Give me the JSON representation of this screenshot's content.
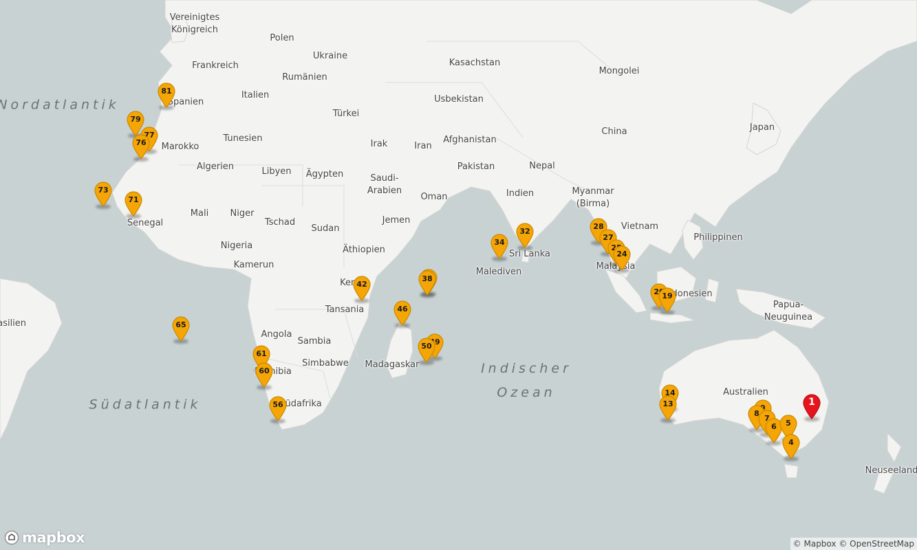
{
  "map": {
    "colors": {
      "water": "#c9d2d3",
      "land": "#f3f3f1",
      "border": "#d4d4d2",
      "marker": "#f5a506",
      "marker_stroke": "#c98a00",
      "marker_active": "#e8141c"
    },
    "country_labels": [
      {
        "text": "Vereinigtes\nKönigreich"
      },
      {
        "text": "Polen"
      },
      {
        "text": "Ukraine"
      },
      {
        "text": "Frankreich"
      },
      {
        "text": "Rumänien"
      },
      {
        "text": "Kasachstan"
      },
      {
        "text": "Mongolei"
      },
      {
        "text": "Spanien"
      },
      {
        "text": "Italien"
      },
      {
        "text": "Usbekistan"
      },
      {
        "text": "Türkei"
      },
      {
        "text": "China"
      },
      {
        "text": "Japan"
      },
      {
        "text": "Marokko"
      },
      {
        "text": "Tunesien"
      },
      {
        "text": "Irak"
      },
      {
        "text": "Iran"
      },
      {
        "text": "Afghanistan"
      },
      {
        "text": "Algerien"
      },
      {
        "text": "Libyen"
      },
      {
        "text": "Ägypten"
      },
      {
        "text": "Pakistan"
      },
      {
        "text": "Nepal"
      },
      {
        "text": "Saudi-\nArabien"
      },
      {
        "text": "Indien"
      },
      {
        "text": "Oman"
      },
      {
        "text": "Myanmar\n(Birma)"
      },
      {
        "text": "Mali"
      },
      {
        "text": "Niger"
      },
      {
        "text": "Senegal"
      },
      {
        "text": "Tschad"
      },
      {
        "text": "Sudan"
      },
      {
        "text": "Jemen"
      },
      {
        "text": "Vietnam"
      },
      {
        "text": "Philippinen"
      },
      {
        "text": "Nigeria"
      },
      {
        "text": "Äthiopien"
      },
      {
        "text": "Kamerun"
      },
      {
        "text": "Sri Lanka"
      },
      {
        "text": "Malaysia"
      },
      {
        "text": "Malediven"
      },
      {
        "text": "Kenia"
      },
      {
        "text": "Tansania"
      },
      {
        "text": "Indonesien"
      },
      {
        "text": "Papua-\nNeuguinea"
      },
      {
        "text": "Brasilien"
      },
      {
        "text": "Angola"
      },
      {
        "text": "Sambia"
      },
      {
        "text": "Namibia"
      },
      {
        "text": "Simbabwe"
      },
      {
        "text": "Madagaskar"
      },
      {
        "text": "Südafrika"
      },
      {
        "text": "Australien"
      },
      {
        "text": "Neuseeland"
      }
    ],
    "ocean_labels": [
      {
        "text": "Nordatlantik"
      },
      {
        "text": "Südatlantik"
      },
      {
        "text": "Indischer\nOzean"
      }
    ],
    "markers": [
      {
        "label": "81"
      },
      {
        "label": "79"
      },
      {
        "label": "77"
      },
      {
        "label": "76"
      },
      {
        "label": "73"
      },
      {
        "label": "71"
      },
      {
        "label": "65"
      },
      {
        "label": "61"
      },
      {
        "label": "60"
      },
      {
        "label": "56"
      },
      {
        "label": "42"
      },
      {
        "label": "46"
      },
      {
        "label": "38"
      },
      {
        "label": "38"
      },
      {
        "label": "49"
      },
      {
        "label": "50"
      },
      {
        "label": "34"
      },
      {
        "label": "32"
      },
      {
        "label": "28"
      },
      {
        "label": "27"
      },
      {
        "label": "25"
      },
      {
        "label": "24"
      },
      {
        "label": "20"
      },
      {
        "label": "19"
      },
      {
        "label": "14"
      },
      {
        "label": "13"
      },
      {
        "label": "9"
      },
      {
        "label": "8"
      },
      {
        "label": "7"
      },
      {
        "label": "6"
      },
      {
        "label": "5"
      },
      {
        "label": "4"
      },
      {
        "label": "1",
        "active": true
      }
    ],
    "logo": "mapbox",
    "attribution": {
      "mapbox": "© Mapbox",
      "osm": "© OpenStreetMap"
    }
  }
}
